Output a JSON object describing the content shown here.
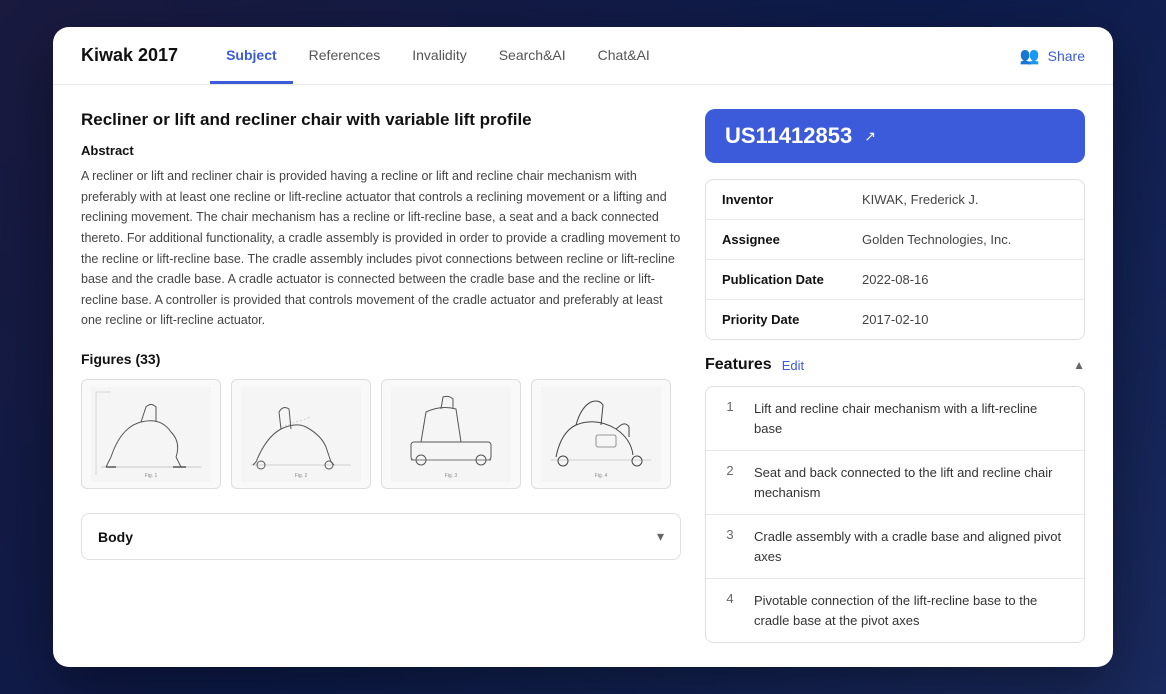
{
  "app": {
    "title": "Kiwak 2017"
  },
  "nav": {
    "tabs": [
      {
        "id": "subject",
        "label": "Subject",
        "active": true
      },
      {
        "id": "references",
        "label": "References",
        "active": false
      },
      {
        "id": "invalidity",
        "label": "Invalidity",
        "active": false
      },
      {
        "id": "searchai",
        "label": "Search&AI",
        "active": false
      },
      {
        "id": "chatai",
        "label": "Chat&AI",
        "active": false
      }
    ],
    "share_label": "Share"
  },
  "main": {
    "patent_title": "Recliner or lift and recliner chair with variable lift profile",
    "abstract_label": "Abstract",
    "abstract_text": "A recliner or lift and recliner chair is provided having a recline or lift and recline chair mechanism with preferably with at least one recline or lift-recline actuator that controls a reclining movement or a lifting and reclining movement. The chair mechanism has a recline or lift-recline base, a seat and a back connected thereto. For additional functionality, a cradle assembly is provided in order to provide a cradling movement to the recline or lift-recline base. The cradle assembly includes pivot connections between recline or lift-recline base and the cradle base. A cradle actuator is connected between the cradle base and the recline or lift-recline base. A controller is provided that controls movement of the cradle actuator and preferably at least one recline or lift-recline actuator.",
    "figures_heading": "Figures (33)",
    "body_label": "Body"
  },
  "sidebar": {
    "patent_id": "US11412853",
    "external_link_symbol": "↗",
    "meta": [
      {
        "key": "Inventor",
        "value": "KIWAK, Frederick J."
      },
      {
        "key": "Assignee",
        "value": "Golden Technologies, Inc."
      },
      {
        "key": "Publication Date",
        "value": "2022-08-16"
      },
      {
        "key": "Priority Date",
        "value": "2017-02-10"
      }
    ],
    "features_title": "Features",
    "edit_label": "Edit",
    "features": [
      {
        "num": "1",
        "text": "Lift and recline chair mechanism with a lift-recline base"
      },
      {
        "num": "2",
        "text": "Seat and back connected to the lift and recline chair mechanism"
      },
      {
        "num": "3",
        "text": "Cradle assembly with a cradle base and aligned pivot axes"
      },
      {
        "num": "4",
        "text": "Pivotable connection of the lift-recline base to the cradle base at the pivot axes"
      }
    ]
  },
  "colors": {
    "accent": "#3b5bdb",
    "text_primary": "#111111",
    "text_secondary": "#444444",
    "border": "#e0e0e0"
  }
}
